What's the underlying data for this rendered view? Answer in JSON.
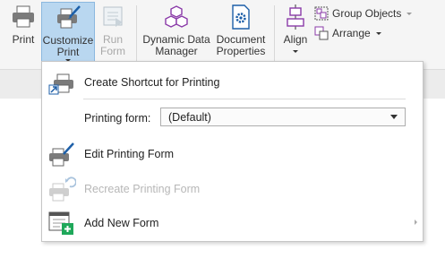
{
  "ribbon": {
    "print": "Print",
    "customize_line1": "Customize",
    "customize_line2": "Print",
    "run_line1": "Run",
    "run_line2": "Form",
    "ddm_line1": "Dynamic Data",
    "ddm_line2": "Manager",
    "doc_line1": "Document",
    "doc_line2": "Properties",
    "align": "Align",
    "group_objects": "Group Objects",
    "arrange": "Arrange"
  },
  "menu": {
    "create_shortcut": "Create Shortcut for Printing",
    "printing_form_label": "Printing form:",
    "printing_form_value": "(Default)",
    "edit_form": "Edit Printing Form",
    "recreate_form": "Recreate Printing Form",
    "add_form": "Add New Form"
  },
  "colors": {
    "accent_active": "#b9d7f0",
    "icon_purple": "#8a3aa8",
    "icon_blue": "#1d5fa8",
    "icon_green": "#1fa85a"
  }
}
